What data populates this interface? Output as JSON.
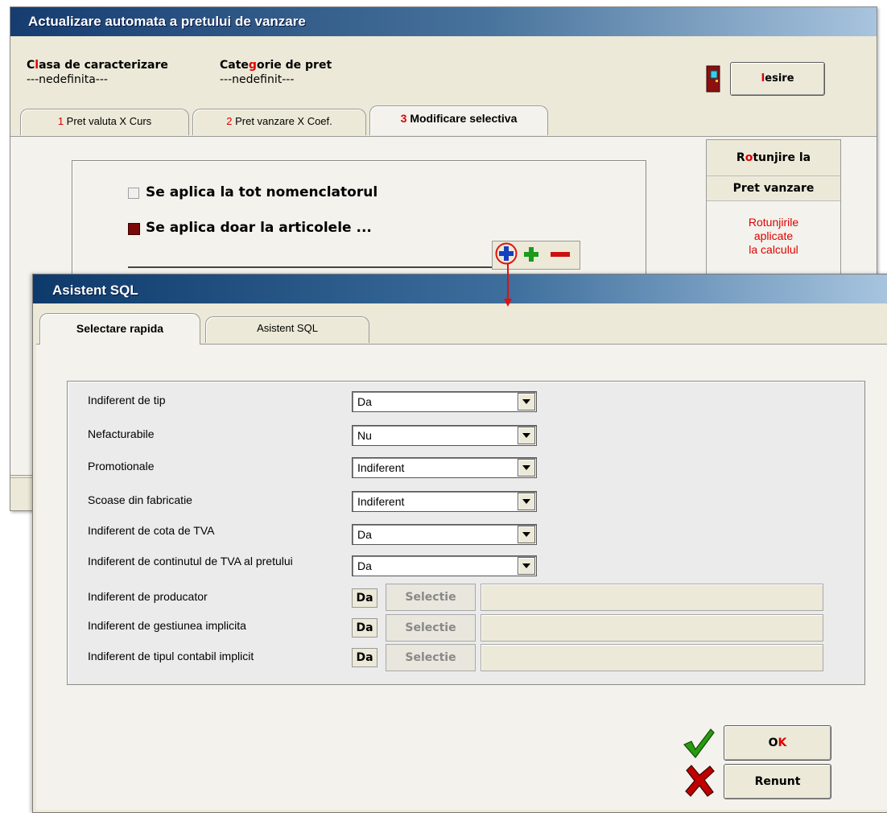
{
  "main_window": {
    "title": "Actualizare automata a pretului de vanzare",
    "clasa_label_first": "C",
    "clasa_label_accent": "l",
    "clasa_label_rest": "asa de caracterizare",
    "clasa_value": "---nedefinita---",
    "categorie_label_first": "Cate",
    "categorie_label_accent": "g",
    "categorie_label_rest": "orie de pret",
    "categorie_value": "---nedefinit---",
    "iesire_label_first": "I",
    "iesire_label_rest": "esire",
    "tabs": [
      {
        "num": "1",
        "label": "Pret valuta X Curs"
      },
      {
        "num": "2",
        "label": "Pret vanzare X Coef."
      },
      {
        "num": "3",
        "label": "Modificare selectiva"
      }
    ],
    "option_all": "Se aplica la tot nomenclatorul",
    "option_only": "Se aplica doar la articolele ...",
    "side_panel": {
      "header_first": "R",
      "header_accent": "o",
      "header_rest": "tunjire la",
      "subheader": "Pret vanzare",
      "note_lines": [
        "Rotunjirile",
        "aplicate",
        "la calculul"
      ]
    }
  },
  "sql_dialog": {
    "title": "Asistent SQL",
    "tabs": [
      "Selectare rapida",
      "Asistent SQL"
    ],
    "rows": [
      {
        "label": "Indiferent de tip",
        "value": "Da"
      },
      {
        "label": "Nefacturabile",
        "value": "Nu"
      },
      {
        "label": "Promotionale",
        "value": "Indiferent"
      },
      {
        "label": "Scoase din fabricatie",
        "value": "Indiferent"
      },
      {
        "label": "Indiferent de cota de TVA",
        "value": "Da"
      },
      {
        "label": "Indiferent de continutul de TVA al pretului",
        "value": "Da"
      }
    ],
    "selection_rows": [
      {
        "label": "Indiferent de producator",
        "badge": "Da",
        "button": "Selectie",
        "field": ""
      },
      {
        "label": "Indiferent de gestiunea implicita",
        "badge": "Da",
        "button": "Selectie",
        "field": ""
      },
      {
        "label": "Indiferent de tipul contabil implicit",
        "badge": "Da",
        "button": "Selectie",
        "field": ""
      }
    ],
    "ok_first": "O",
    "ok_accent": "K",
    "cancel_label": "Renunt"
  },
  "colors": {
    "accent_red": "#e00000",
    "check_green": "#2a9a10",
    "cross_red": "#c00000",
    "plus_blue": "#1540c0",
    "plus_green": "#1c9a1c",
    "minus_red": "#cc1010"
  }
}
